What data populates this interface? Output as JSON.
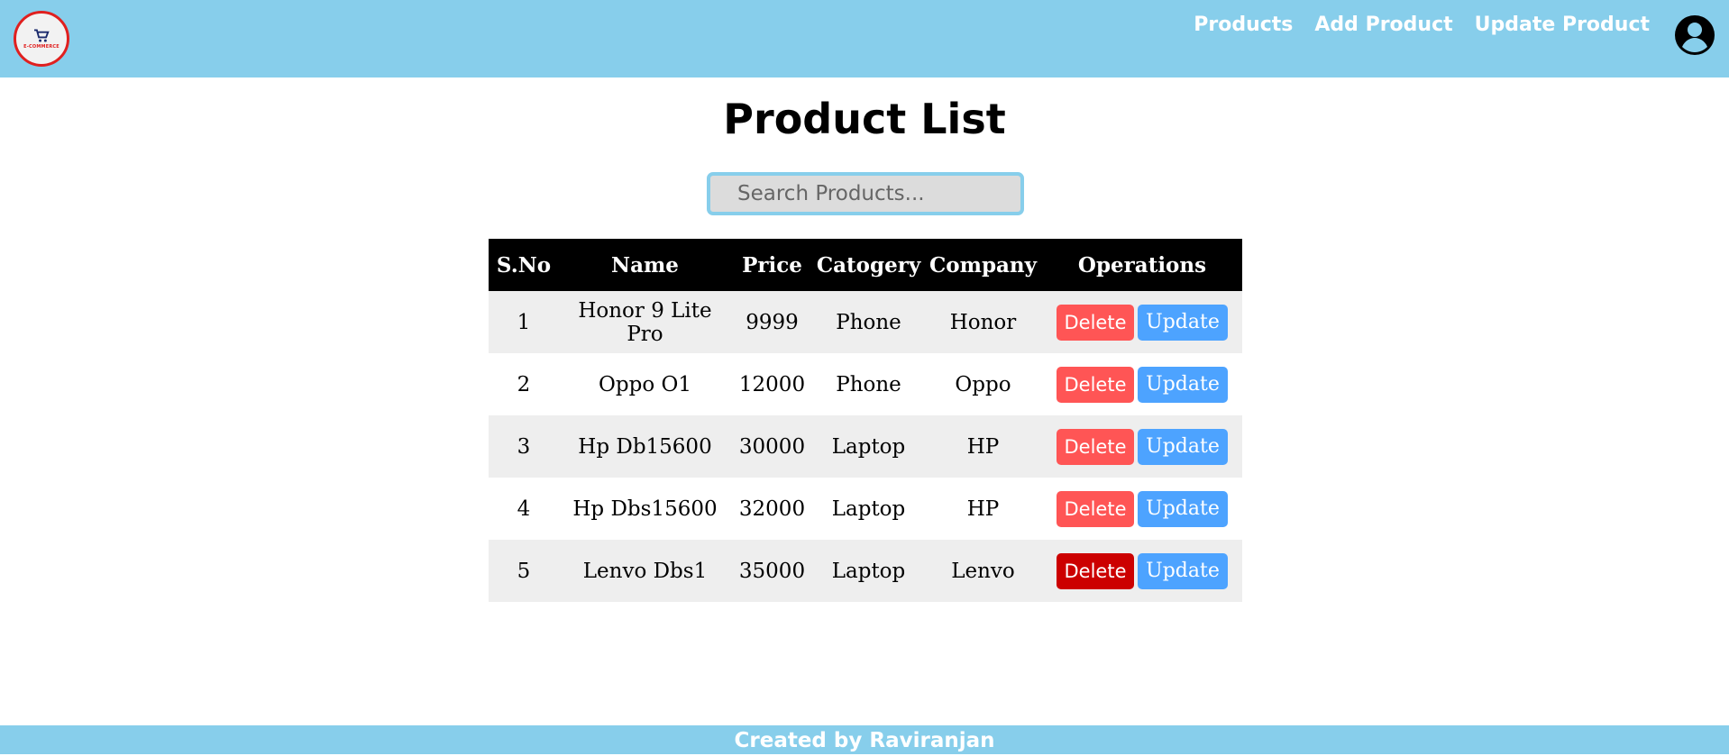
{
  "navbar": {
    "logo_text": "E-COMMERCE",
    "links": [
      "Products",
      "Add Product",
      "Update Product"
    ]
  },
  "page": {
    "title": "Product List",
    "search_placeholder": "Search Products..."
  },
  "table": {
    "headers": [
      "S.No",
      "Name",
      "Price",
      "Catogery",
      "Company",
      "Operations"
    ],
    "rows": [
      {
        "sno": "1",
        "name": "Honor 9 Lite Pro",
        "price": "9999",
        "category": "Phone",
        "company": "Honor"
      },
      {
        "sno": "2",
        "name": "Oppo O1",
        "price": "12000",
        "category": "Phone",
        "company": "Oppo"
      },
      {
        "sno": "3",
        "name": "Hp Db15600",
        "price": "30000",
        "category": "Laptop",
        "company": "HP"
      },
      {
        "sno": "4",
        "name": "Hp Dbs15600",
        "price": "32000",
        "category": "Laptop",
        "company": "HP"
      },
      {
        "sno": "5",
        "name": "Lenvo Dbs1",
        "price": "35000",
        "category": "Laptop",
        "company": "Lenvo"
      }
    ],
    "delete_label": "Delete",
    "update_label": "Update"
  },
  "footer": {
    "text": "Created by Raviranjan"
  },
  "icons": {
    "logo": "shopping-cart-icon",
    "user": "user-avatar-icon"
  },
  "colors": {
    "navbar": "#87ceeb",
    "delete": "#ff5555",
    "delete_hover": "#cc0000",
    "update": "#4da3ff",
    "logo_border": "#e0201f"
  }
}
